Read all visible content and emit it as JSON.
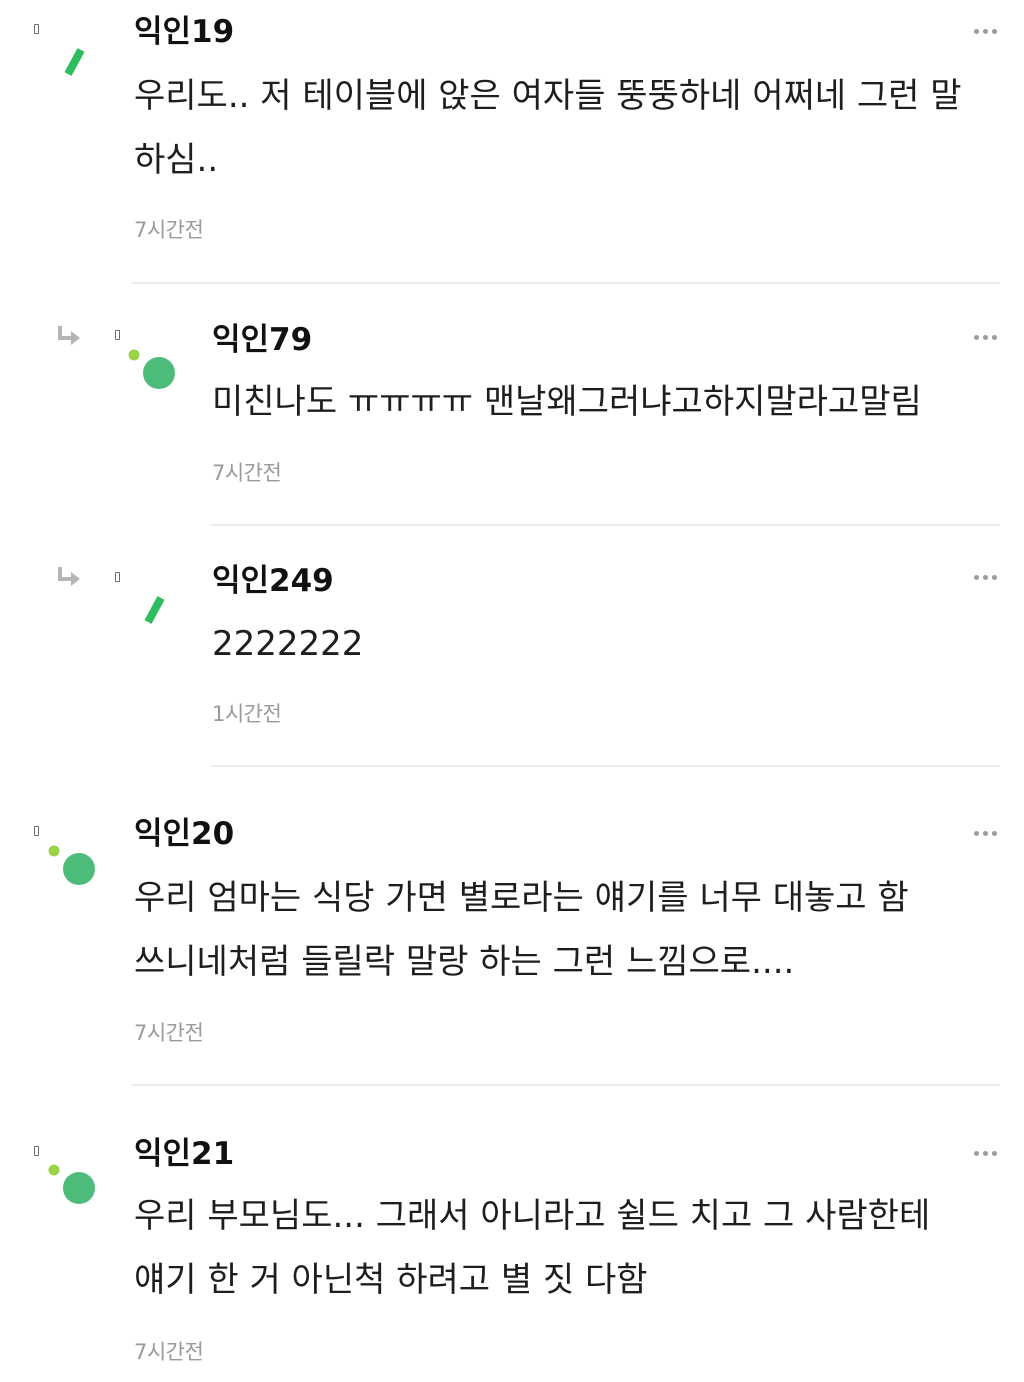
{
  "comments": [
    {
      "nick": "익인19",
      "text": "우리도.. 저 테이블에 앉은 여자들 뚱뚱하네 어쩌네 그런 말 하심..",
      "time": "7시간전",
      "is_reply": false,
      "avatar": "green-stroke-avatar",
      "more_icon": "more-dots-icon"
    },
    {
      "nick": "익인79",
      "text": "미친나도 ㅠㅠㅠㅠ 맨날왜그러냐고하지말라고말림",
      "time": "7시간전",
      "is_reply": true,
      "avatar": "green-dots-avatar",
      "more_icon": "more-dots-icon"
    },
    {
      "nick": "익인249",
      "text": "2222222",
      "time": "1시간전",
      "is_reply": true,
      "avatar": "green-stroke-avatar",
      "more_icon": "more-dots-icon"
    },
    {
      "nick": "익인20",
      "text": "우리 엄마는 식당 가면 별로라는 얘기를 너무 대놓고 함 쓰니네처럼 들릴락 말랑 하는 그런 느낌으로....",
      "time": "7시간전",
      "is_reply": false,
      "avatar": "green-dots-avatar",
      "more_icon": "more-dots-icon"
    },
    {
      "nick": "익인21",
      "text": "우리 부모님도... 그래서 아니라고 쉴드 치고 그 사람한테 얘기 한 거 아닌척 하려고 별 짓 다함",
      "time": "7시간전",
      "is_reply": false,
      "avatar": "green-dots-avatar",
      "more_icon": "more-dots-icon"
    }
  ],
  "colors": {
    "avatar_green": "#4dbb7a",
    "avatar_lime": "#9ad24a",
    "stroke_green": "#2ebd5c",
    "muted_text": "#9a9a9a",
    "divider": "#ececec"
  }
}
